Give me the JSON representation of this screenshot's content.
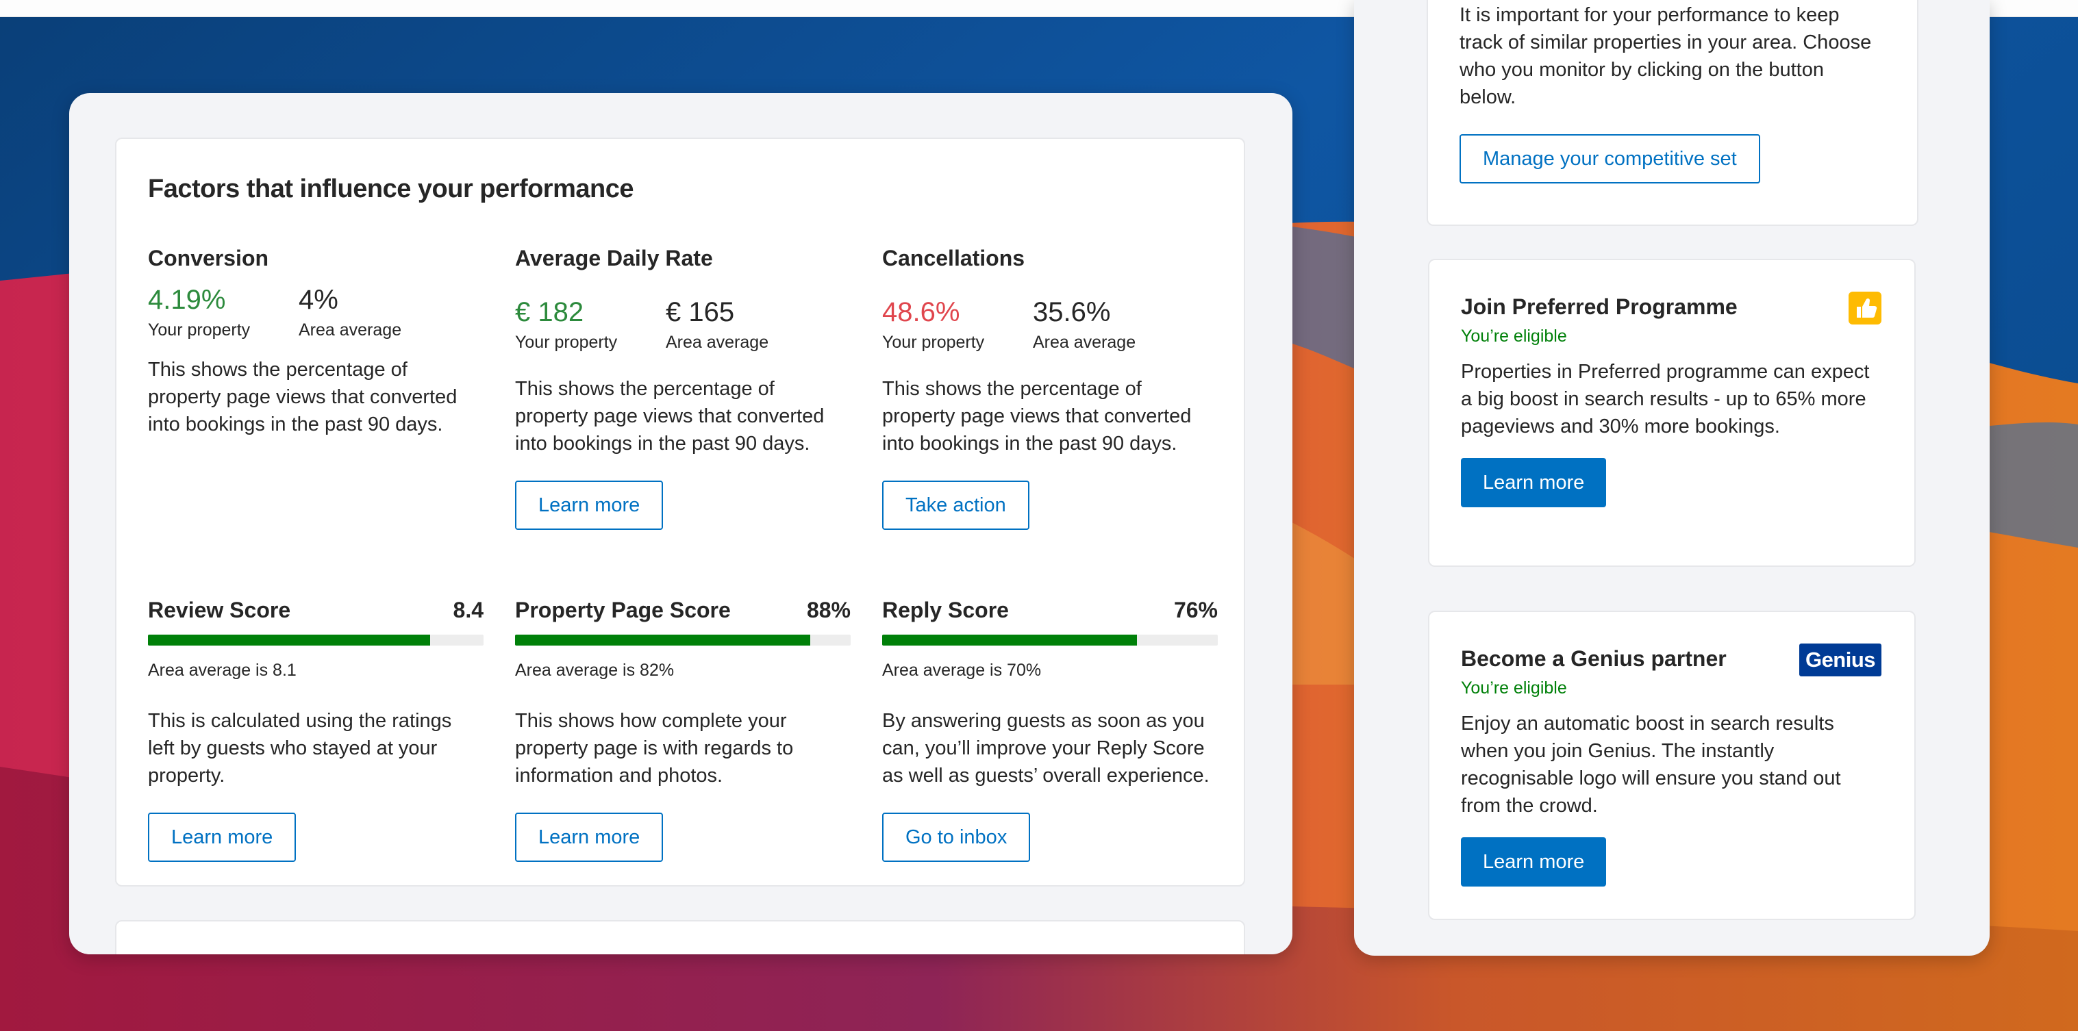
{
  "factors": {
    "title": "Factors that influence your performance",
    "metrics": [
      {
        "title": "Conversion",
        "your_value": "4.19%",
        "your_label": "Your property",
        "area_value": "4%",
        "area_label": "Area average",
        "description": "This shows the percentage of property page views that converted into bookings in the past 90 days.",
        "button": ""
      },
      {
        "title": "Average Daily Rate",
        "your_value": "€ 182",
        "your_label": "Your property",
        "area_value": "€ 165",
        "area_label": "Area average",
        "description": "This shows the percentage of property page views that converted into bookings in the past 90 days.",
        "button": "Learn more"
      },
      {
        "title": "Cancellations",
        "your_value": "48.6%",
        "your_label": "Your property",
        "area_value": "35.6%",
        "area_label": "Area average",
        "description": "This shows the percentage of property page views that converted into bookings in the past 90 days.",
        "button": "Take action"
      }
    ],
    "scores": [
      {
        "title": "Review Score",
        "value": "8.4",
        "progress": 0.84,
        "average": "Area average is 8.1",
        "description": "This is calculated using the ratings left by guests who stayed at your property.",
        "button": "Learn more"
      },
      {
        "title": "Property Page Score",
        "value": "88%",
        "progress": 0.88,
        "average": "Area average is 82%",
        "description": "This shows how complete your property page is with regards to information and photos.",
        "button": "Learn more"
      },
      {
        "title": "Reply Score",
        "value": "76%",
        "progress": 0.76,
        "average": "Area average is 70%",
        "description": "By answering guests as soon as you can, you’ll improve your Reply Score as well as guests’ overall experience.",
        "button": "Go to inbox"
      }
    ]
  },
  "competitive": {
    "text": "It is important for your performance to keep track of similar properties in your area. Choose who you monitor by clicking on the button below.",
    "button": "Manage your competitive set"
  },
  "preferred": {
    "title": "Join Preferred Programme",
    "status": "You’re eligible",
    "description": "Properties in Preferred programme can expect a big boost in search results - up to 65% more pageviews and 30% more bookings.",
    "button": "Learn more",
    "icon": "thumbs-up-icon"
  },
  "genius": {
    "title": "Become a Genius partner",
    "status": "You’re eligible",
    "logo_text": "Genius",
    "description": "Enjoy an automatic boost in search results when you join Genius. The instantly recognisable logo will ensure you stand out from the crowd.",
    "button": "Learn more"
  },
  "colors": {
    "brand_blue": "#0071c2",
    "positive_green": "#2c8a3c",
    "negative_red": "#e0464d",
    "progress_green": "#008009",
    "genius_navy": "#003b95",
    "badge_yellow": "#febb02"
  }
}
